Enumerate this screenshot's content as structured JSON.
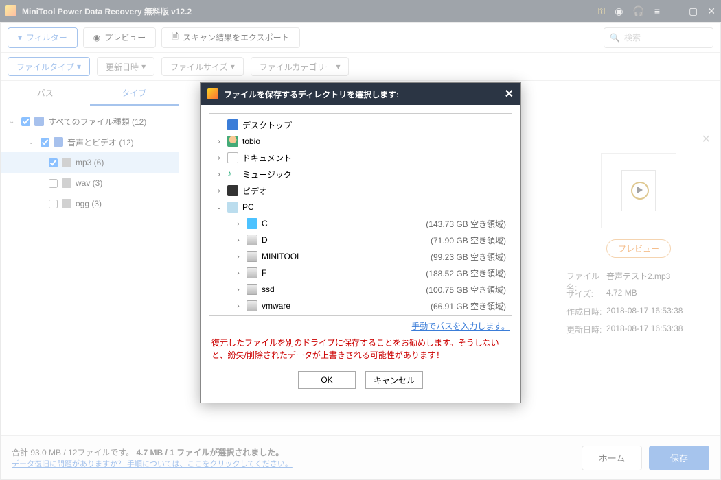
{
  "titlebar": {
    "title": "MiniTool Power Data Recovery 無料版 v12.2"
  },
  "toolbar": {
    "filter": "フィルター",
    "preview": "プレビュー",
    "export": "スキャン結果をエクスポート",
    "search_placeholder": "検索"
  },
  "filters": {
    "file_type": "ファイルタイプ",
    "date": "更新日時",
    "size": "ファイルサイズ",
    "category": "ファイルカテゴリー"
  },
  "sidebar_tabs": {
    "path": "パス",
    "type": "タイプ"
  },
  "tree": {
    "all": "すべてのファイル種類 (12)",
    "av": "音声とビデオ (12)",
    "mp3": "mp3 (6)",
    "wav": "wav (3)",
    "ogg": "ogg (3)"
  },
  "rightpane": {
    "preview_btn": "プレビュー",
    "labels": {
      "name": "ファイル名:",
      "size": "サイズ:",
      "created": "作成日時:",
      "modified": "更新日時:"
    },
    "values": {
      "name": "音声テスト2.mp3",
      "size": "4.72 MB",
      "created": "2018-08-17 16:53:38",
      "modified": "2018-08-17 16:53:38"
    }
  },
  "modal": {
    "title": "ファイルを保存するディレクトリを選択します:",
    "items": {
      "desktop": "デスクトップ",
      "user": "tobio",
      "documents": "ドキュメント",
      "music": "ミュージック",
      "video": "ビデオ",
      "pc": "PC"
    },
    "drives": [
      {
        "name": "C",
        "size": "(143.73 GB 空き領域)",
        "icon": "win"
      },
      {
        "name": "D",
        "size": "(71.90 GB 空き領域)",
        "icon": "drive"
      },
      {
        "name": "MINITOOL",
        "size": "(99.23 GB 空き領域)",
        "icon": "drive"
      },
      {
        "name": "F",
        "size": "(188.52 GB 空き領域)",
        "icon": "drive"
      },
      {
        "name": "ssd",
        "size": "(100.75 GB 空き領域)",
        "icon": "drive"
      },
      {
        "name": "vmware",
        "size": "(66.91 GB 空き領域)",
        "icon": "drive"
      }
    ],
    "manual_path": "手動でパスを入力します。",
    "warning": "復元したファイルを別のドライブに保存することをお勧めします。そうしないと、紛失/削除されたデータが上書きされる可能性があります！",
    "ok": "OK",
    "cancel": "キャンセル"
  },
  "footer": {
    "summary_a": "合計 93.0 MB / 12ファイルです。",
    "summary_b": "4.7 MB / 1 ファイルが選択されました。",
    "help": "データ復旧に問題がありますか？ 手順については、ここをクリックしてください。",
    "home": "ホーム",
    "save": "保存"
  }
}
